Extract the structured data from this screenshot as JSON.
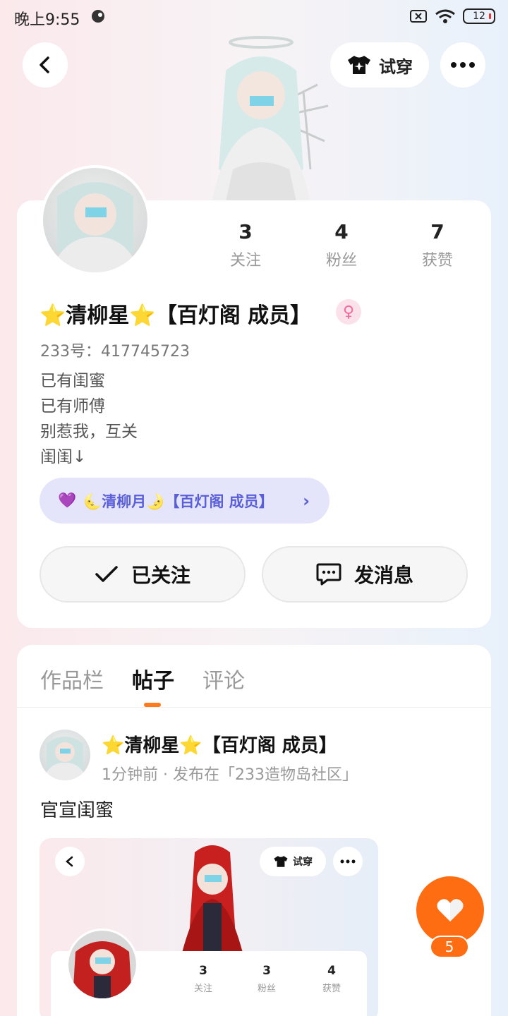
{
  "status_bar": {
    "time": "晚上9:55",
    "battery": "12"
  },
  "top_bar": {
    "try_on_label": "试穿"
  },
  "profile": {
    "stats": [
      {
        "value": "3",
        "label": "关注"
      },
      {
        "value": "4",
        "label": "粉丝"
      },
      {
        "value": "7",
        "label": "获赞"
      }
    ],
    "username": "⭐清柳星⭐【百灯阁 成员】",
    "gender": "♀",
    "user_id": "233号：417745723",
    "bio": [
      "已有闺蜜",
      "已有师傅",
      "别惹我，互关",
      "闺闺↓"
    ],
    "relation": {
      "icon": "💜",
      "text": "🌜清柳月🌛【百灯阁 成员】"
    },
    "follow_label": "已关注",
    "message_label": "发消息"
  },
  "tabs": [
    {
      "label": "作品栏",
      "active": false
    },
    {
      "label": "帖子",
      "active": true
    },
    {
      "label": "评论",
      "active": false
    }
  ],
  "post": {
    "author": "⭐清柳星⭐【百灯阁 成员】",
    "meta": "1分钟前 · 发布在「233造物岛社区」",
    "text": "官宣闺蜜",
    "embedded": {
      "try_on_label": "试穿",
      "stats": [
        {
          "value": "3",
          "label": "关注"
        },
        {
          "value": "3",
          "label": "粉丝"
        },
        {
          "value": "4",
          "label": "获赞"
        }
      ]
    }
  },
  "like": {
    "count": "5"
  },
  "colors": {
    "accent": "#ff6d12",
    "relation": "#5a5fd8"
  },
  "icons": [
    "back-icon",
    "tshirt-icon",
    "more-icon",
    "check-icon",
    "chat-icon",
    "heart-icon",
    "female-icon"
  ]
}
